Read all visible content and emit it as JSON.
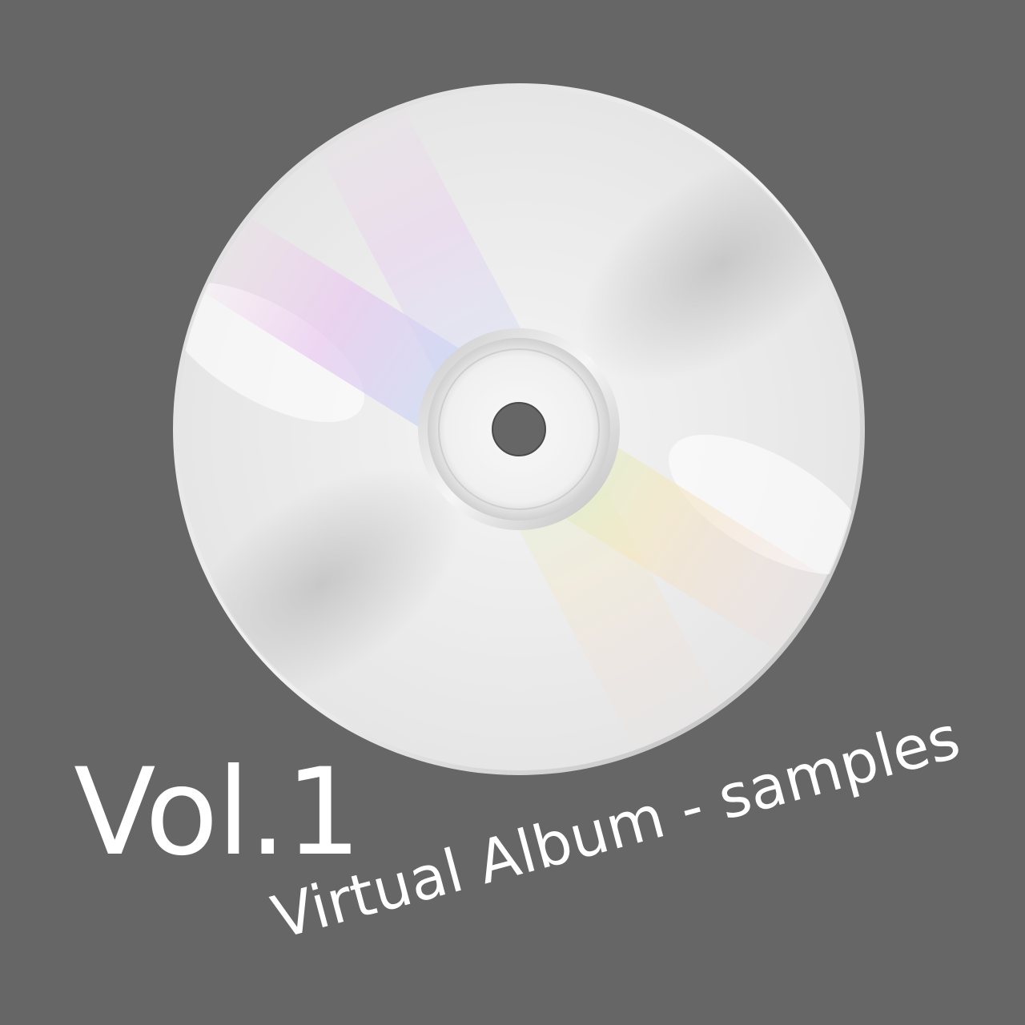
{
  "cover": {
    "title": "Vol.1",
    "subtitle": "Virtual Album - samples",
    "disc_icon": "compact-disc-icon"
  },
  "colors": {
    "background": "#666666",
    "text": "#ffffff",
    "disc_surface": "#e8e8e8",
    "disc_rim": "#bdbdbd",
    "center_hole": "#666666"
  }
}
